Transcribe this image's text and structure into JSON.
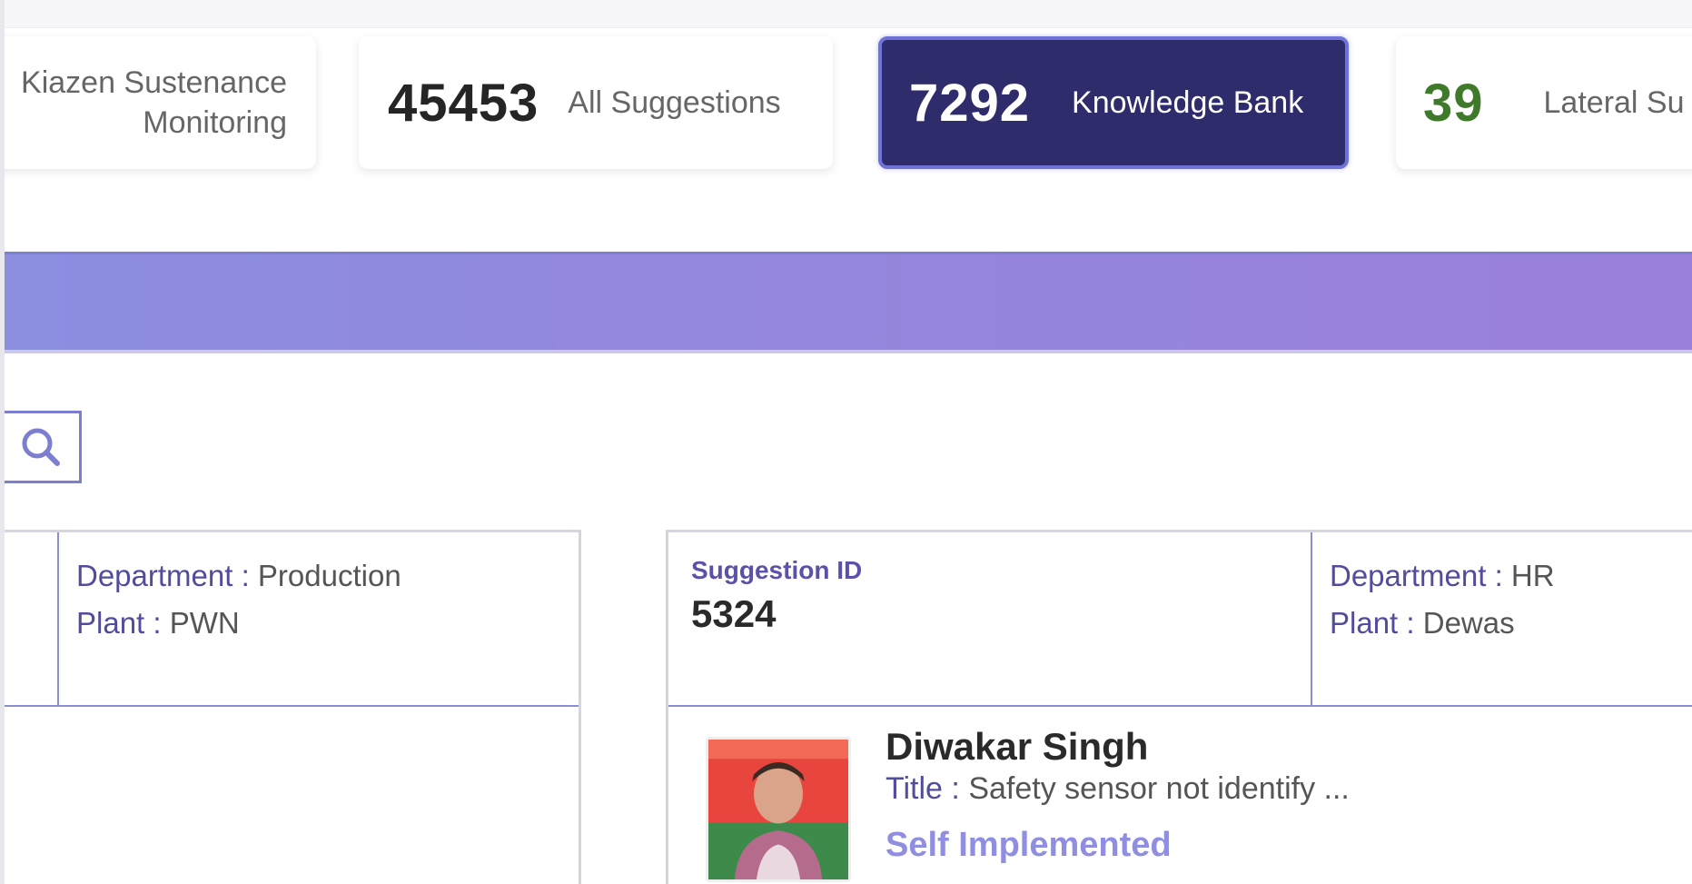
{
  "stats": {
    "kaizen": {
      "label_line1": "Kiazen Sustenance",
      "label_line2": "Monitoring"
    },
    "all_suggestions": {
      "count": "45453",
      "label": "All Suggestions"
    },
    "knowledge_bank": {
      "count": "7292",
      "label": "Knowledge Bank"
    },
    "lateral": {
      "count": "39",
      "label": "Lateral Su"
    }
  },
  "colors": {
    "accent": "#2f2c6b",
    "banner": "#9585dc",
    "lateral_count": "#3f7a2a",
    "status": "#8f8ee0"
  },
  "search": {
    "icon": "search-icon"
  },
  "cards": {
    "left": {
      "department_key": "Department :",
      "department_value": "Production",
      "plant_key": "Plant :",
      "plant_value": "PWN"
    },
    "right": {
      "suggestion_id_label": "Suggestion ID",
      "suggestion_id": "5324",
      "department_key": "Department :",
      "department_value": "HR",
      "plant_key": "Plant :",
      "plant_value": "Dewas",
      "name": "Diwakar Singh",
      "title_key": "Title :",
      "title_value": "Safety sensor not identify ...",
      "status": "Self Implemented"
    }
  }
}
